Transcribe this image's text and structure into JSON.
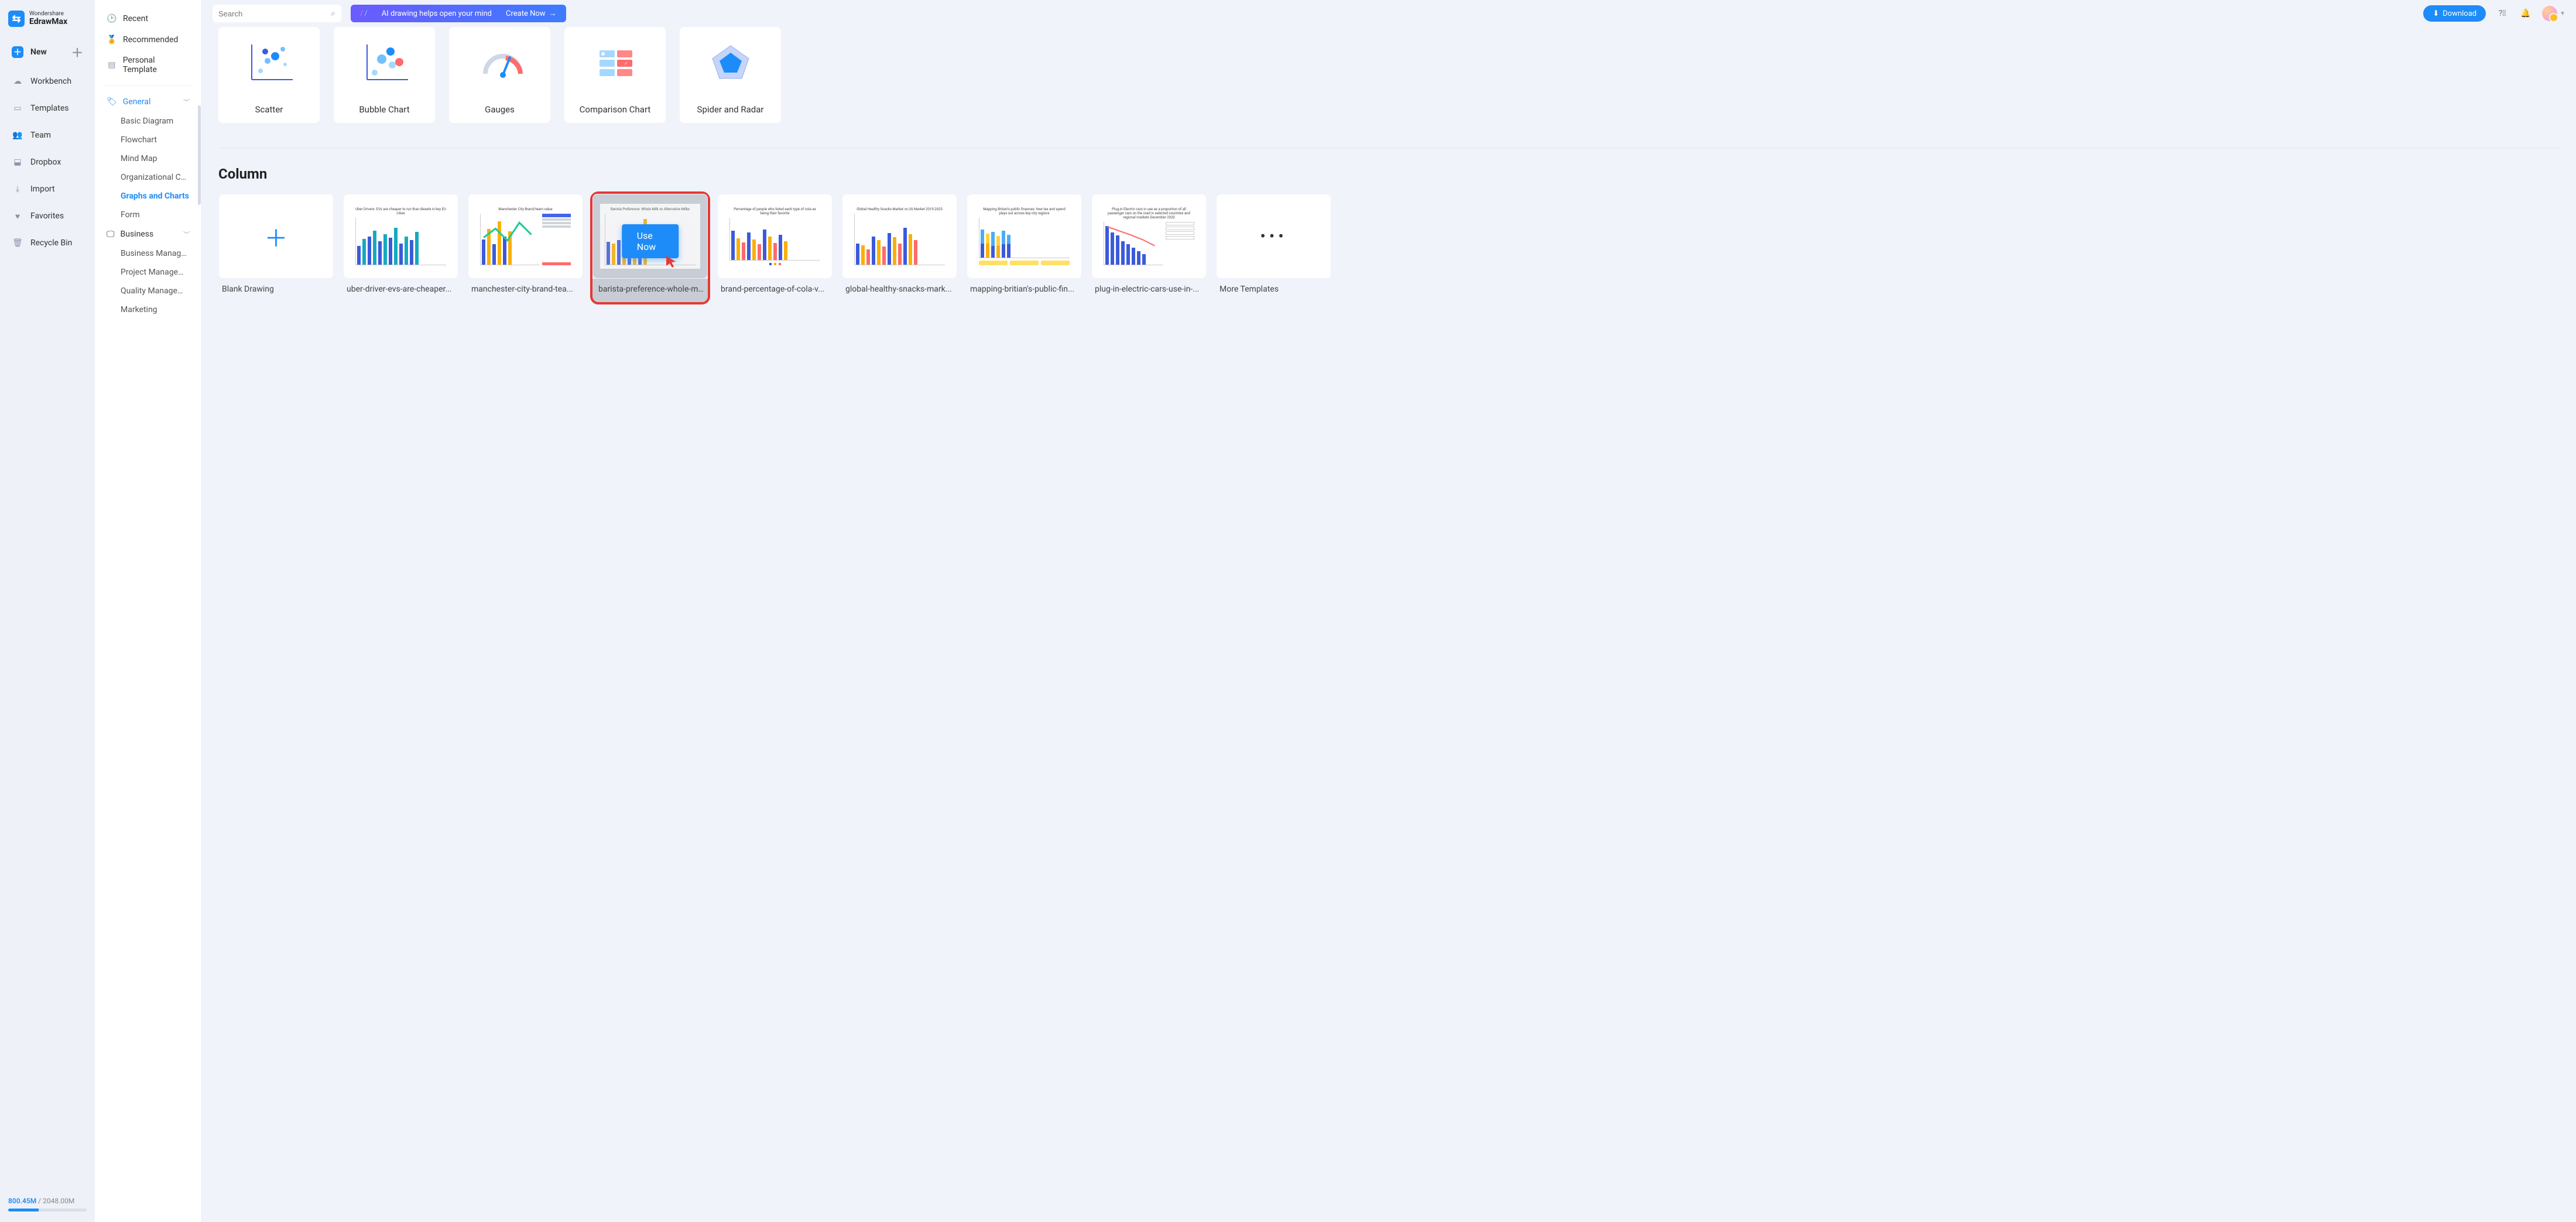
{
  "brand": {
    "top": "Wondershare",
    "bottom": "EdrawMax"
  },
  "primary_nav": {
    "new": "New",
    "items": [
      "Workbench",
      "Templates",
      "Team",
      "Dropbox",
      "Import",
      "Favorites",
      "Recycle Bin"
    ]
  },
  "storage": {
    "used": "800.45M",
    "sep": " / ",
    "total": "2048.00M"
  },
  "secondary": {
    "top": [
      "Recent",
      "Recommended",
      "Personal Template"
    ],
    "categories": [
      {
        "label": "General",
        "active": true,
        "subs": [
          {
            "label": "Basic Diagram"
          },
          {
            "label": "Flowchart"
          },
          {
            "label": "Mind Map"
          },
          {
            "label": "Organizational Chart"
          },
          {
            "label": "Graphs and Charts",
            "active": true
          },
          {
            "label": "Form"
          }
        ]
      },
      {
        "label": "Business",
        "subs": [
          {
            "label": "Business Management"
          },
          {
            "label": "Project Management"
          },
          {
            "label": "Quality Management"
          },
          {
            "label": "Marketing"
          }
        ]
      }
    ]
  },
  "topbar": {
    "search_placeholder": "Search",
    "ai_text": "AI drawing helps open your mind",
    "ai_cta": "Create Now",
    "download": "Download"
  },
  "chart_types": [
    {
      "label": "Scatter"
    },
    {
      "label": "Bubble Chart"
    },
    {
      "label": "Gauges"
    },
    {
      "label": "Comparison Chart"
    },
    {
      "label": "Spider and Radar"
    }
  ],
  "section": {
    "title": "Column"
  },
  "templates_row1": [
    {
      "label": "Blank Drawing",
      "kind": "blank"
    },
    {
      "label": "uber-driver-evs-are-cheaper..."
    },
    {
      "label": "manchester-city-brand-tea..."
    },
    {
      "label": "barista-preference-whole-m...",
      "highlight": true,
      "use_now": "Use Now"
    },
    {
      "label": "brand-percentage-of-cola-v..."
    }
  ],
  "templates_row2": [
    {
      "label": "global-healthy-snacks-mark..."
    },
    {
      "label": "mapping-britian's-public-fin..."
    },
    {
      "label": "plug-in-electric-cars-use-in-..."
    },
    {
      "label": "More Templates",
      "kind": "more"
    }
  ]
}
